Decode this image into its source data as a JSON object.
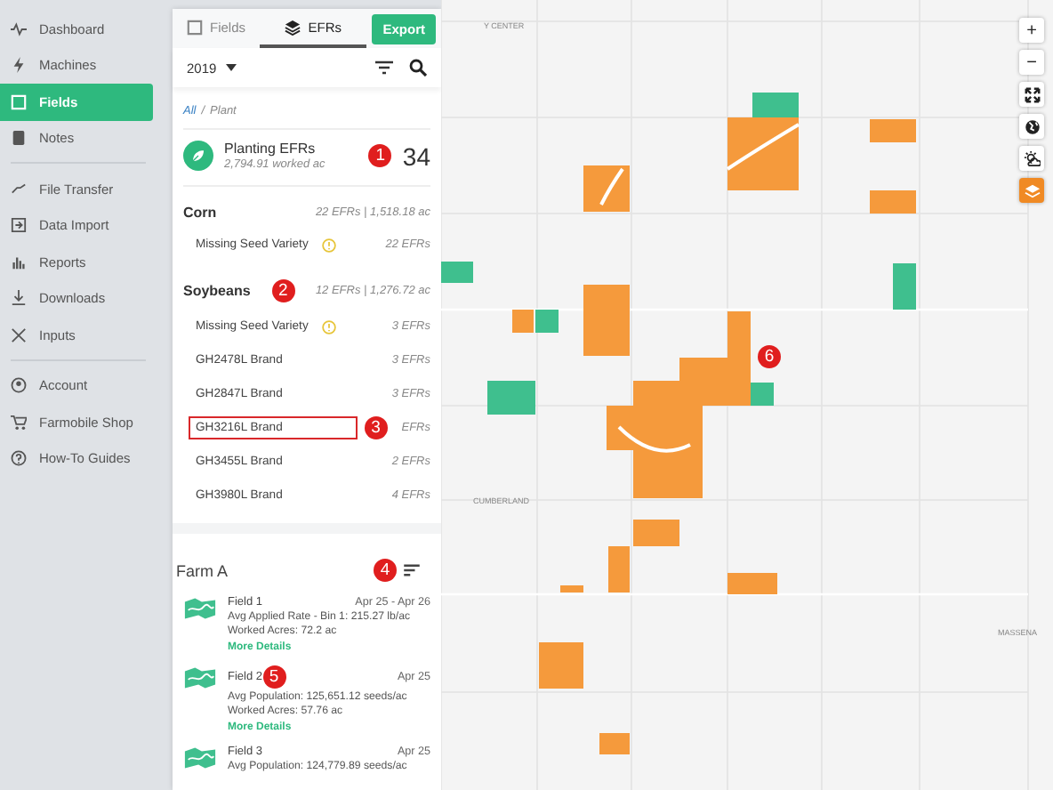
{
  "sidebar": {
    "groups": [
      [
        {
          "label": "Dashboard",
          "selected": false
        },
        {
          "label": "Machines",
          "selected": false
        },
        {
          "label": "Fields",
          "selected": true
        },
        {
          "label": "Notes",
          "selected": false
        }
      ],
      [
        {
          "label": "File Transfer",
          "selected": false
        },
        {
          "label": "Data Import",
          "selected": false
        },
        {
          "label": "Reports",
          "selected": false
        },
        {
          "label": "Downloads",
          "selected": false
        },
        {
          "label": "Inputs",
          "selected": false
        }
      ],
      [
        {
          "label": "Account",
          "selected": false
        },
        {
          "label": "Farmobile Shop",
          "selected": false
        },
        {
          "label": "How-To Guides",
          "selected": false
        }
      ]
    ]
  },
  "panel": {
    "tabs": [
      {
        "label": "Fields",
        "selected": false
      },
      {
        "label": "EFRs",
        "selected": true
      }
    ],
    "export_button": "Export",
    "year": "2019",
    "breadcrumb": {
      "link": "All",
      "separator": "/",
      "current": "Plant"
    },
    "summary": {
      "title": "Planting EFRs",
      "subtitle": "2,794.91 worked ac",
      "count": "34",
      "callout": "1"
    },
    "crops": [
      {
        "name": "Corn",
        "totals": "22 EFRs | 1,518.18 ac",
        "varieties": [
          {
            "name": "Missing Seed Variety",
            "warning": true,
            "count": "22 EFRs",
            "highlighted": false
          }
        ]
      },
      {
        "name": "Soybeans",
        "totals": "12 EFRs | 1,276.72 ac",
        "callout": "2",
        "varieties": [
          {
            "name": "Missing Seed Variety",
            "warning": true,
            "count": "3 EFRs",
            "highlighted": false
          },
          {
            "name": "GH2478L Brand",
            "warning": false,
            "count": "3 EFRs",
            "highlighted": false
          },
          {
            "name": "GH2847L Brand",
            "warning": false,
            "count": "3 EFRs",
            "highlighted": false
          },
          {
            "name": "GH3216L Brand",
            "warning": false,
            "count": "EFRs",
            "highlighted": true,
            "callout": "3"
          },
          {
            "name": "GH3455L Brand",
            "warning": false,
            "count": "2 EFRs",
            "highlighted": false
          },
          {
            "name": "GH3980L Brand",
            "warning": false,
            "count": "4 EFRs",
            "highlighted": false
          }
        ]
      }
    ],
    "farm": {
      "name": "Farm A",
      "callout": "4",
      "fields": [
        {
          "name": "Field 1",
          "date": "Apr 25 - Apr 26",
          "metric": "Avg Applied Rate - Bin 1: 215.27 lb/ac",
          "acres": "Worked Acres: 72.2 ac",
          "link": "More Details"
        },
        {
          "name": "Field 2",
          "date": "Apr 25",
          "metric": "Avg Population: 125,651.12 seeds/ac",
          "acres": "Worked Acres: 57.76 ac",
          "link": "More Details",
          "callout": "5"
        },
        {
          "name": "Field 3",
          "date": "Apr 25",
          "metric": "Avg Population: 124,779.89 seeds/ac"
        }
      ]
    }
  },
  "map": {
    "labels": [
      "Y CENTER",
      "CUMBERLAND",
      "MASSENA"
    ],
    "callout": "6",
    "zoom": [
      "+",
      "−"
    ],
    "tools": [
      {
        "selected": false
      },
      {
        "selected": false
      },
      {
        "selected": false
      },
      {
        "selected": true
      }
    ]
  }
}
